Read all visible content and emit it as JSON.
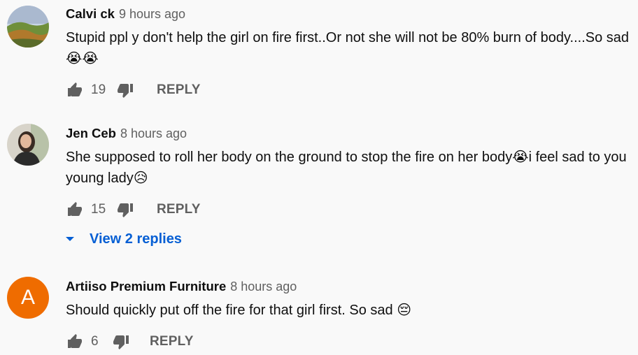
{
  "comments": [
    {
      "author": "Calvi ck",
      "time": "9 hours ago",
      "text": "Stupid ppl y don't help the girl on fire first..Or not she will not be 80% burn of body....So sad 😭😭",
      "likes": "19",
      "reply_label": "REPLY",
      "avatar_icon": "landscape-photo-avatar"
    },
    {
      "author": "Jen Ceb",
      "time": "8 hours ago",
      "text": "She supposed to roll her body on the ground to stop the fire on her body😭i feel sad to you young lady😥",
      "likes": "15",
      "reply_label": "REPLY",
      "view_replies_label": "View 2 replies",
      "avatar_icon": "person-photo-avatar"
    },
    {
      "author": "Artiiso Premium Furniture",
      "time": "8 hours ago",
      "text": "Should quickly put off the fire for that girl first. So sad 😔",
      "likes": "6",
      "reply_label": "REPLY",
      "avatar_letter": "A",
      "avatar_color": "#ef6c00"
    }
  ],
  "colors": {
    "background": "#f9f9f9",
    "link_blue": "#065fd4",
    "secondary_text": "#606060",
    "icon_gray": "#606060"
  }
}
